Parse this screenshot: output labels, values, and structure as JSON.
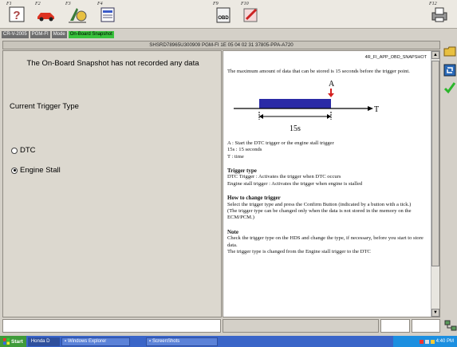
{
  "toolbar": {
    "buttons": [
      {
        "fkey": "F1",
        "icon": "help-icon"
      },
      {
        "fkey": "F2",
        "icon": "car-icon"
      },
      {
        "fkey": "F3",
        "icon": "diagnostic-icon"
      },
      {
        "fkey": "F4",
        "icon": "document-icon"
      },
      {
        "fkey": "F9",
        "icon": "obd-icon",
        "label": "OBD"
      },
      {
        "fkey": "F10",
        "icon": "tools-icon"
      },
      {
        "fkey": "F12",
        "icon": "print-icon"
      }
    ]
  },
  "modebar": {
    "chips": [
      "CR-V-2005",
      "PGM-FI",
      "Mode",
      "On-Board Snapshot"
    ]
  },
  "vinbar": {
    "text": "SHSRD78965U300909  PGM-FI  1E 05 04 02 31  37805-PPA-A720"
  },
  "left": {
    "message": "The On-Board Snapshot has not recorded any data",
    "trigger_label": "Current Trigger Type",
    "options": [
      {
        "label": "DTC",
        "selected": false
      },
      {
        "label": "Engine Stall",
        "selected": true
      }
    ]
  },
  "doc": {
    "code": "4R_FI_APP_OBD_SNAPSHOT",
    "intro": "The maximum amount of data that can be stored is 15 seconds before the trigger point.",
    "diagram": {
      "marker": "A",
      "axis": "T",
      "duration": "15s"
    },
    "legend": [
      "A   : Start the DTC trigger or the engine stall trigger",
      "15s : 15 seconds",
      "T   : time"
    ],
    "sections": [
      {
        "title": "Trigger type",
        "lines": [
          "DTC Trigger : Activates the trigger when DTC occurs",
          "Engine stall trigger : Activates the trigger when engine is stalled"
        ]
      },
      {
        "title": "How to change trigger",
        "lines": [
          "Select the trigger type and press the Confirm Button (indicated by a button with a tick.)",
          "(The trigger type can be changed only when the data is not stored in the memory on the ECM/PCM.)"
        ]
      },
      {
        "title": "Note",
        "lines": [
          "Check the trigger type on the HDS and change the type, if necessary, before you start to store data.",
          "The trigger type is changed from the Engine stall trigger to the DTC"
        ]
      }
    ]
  },
  "taskbar": {
    "start": "Start",
    "tasks": [
      "Honda D",
      "Windows Explorer",
      "ScreenShots"
    ],
    "clock": "4:40 PM"
  },
  "colors": {
    "accent_green": "#39c23c",
    "taskbar_blue": "#3a65c8",
    "start_green": "#3f9b3a",
    "diagram_blue": "#2a2aa6",
    "marker_red": "#d42020"
  }
}
